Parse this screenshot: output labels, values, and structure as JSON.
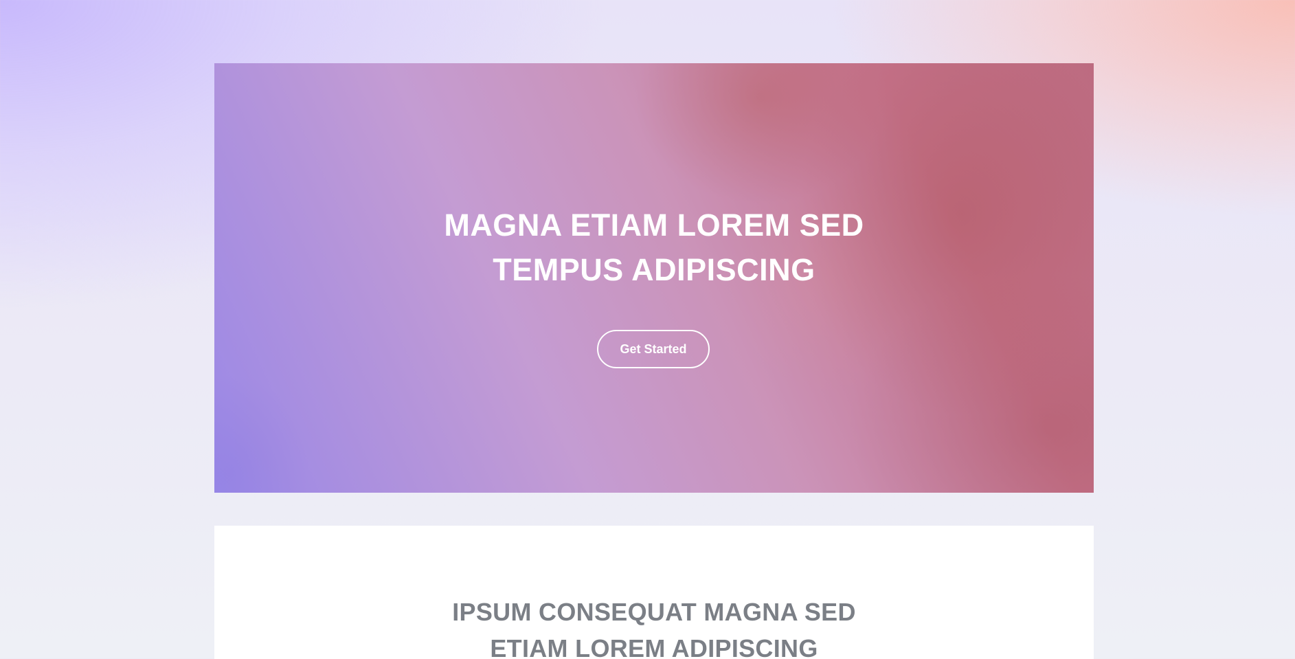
{
  "banner": {
    "title_line1": "MAGNA ETIAM LOREM SED",
    "title_line2": "TEMPUS ADIPISCING",
    "cta_label": "Get Started"
  },
  "section": {
    "title_line1": "IPSUM CONSEQUAT MAGNA SED",
    "title_line2": "ETIAM LOREM ADIPISCING"
  },
  "colors": {
    "banner_text": "#ffffff",
    "section_title": "#7b7f86",
    "section_background": "#ffffff"
  }
}
